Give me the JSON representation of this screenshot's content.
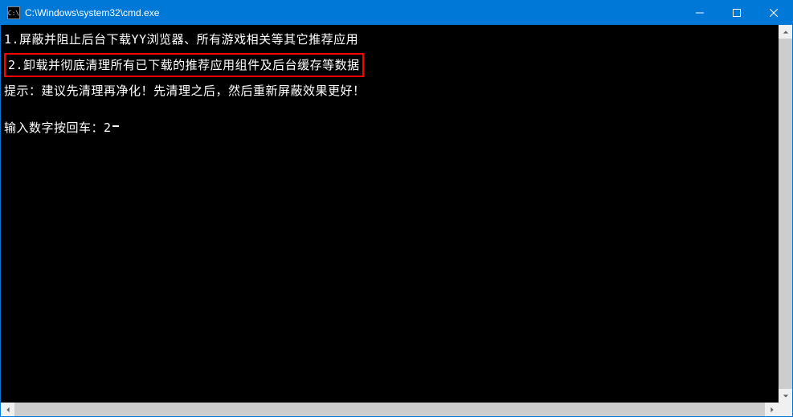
{
  "titlebar": {
    "icon_label": "C:\\",
    "title": "C:\\Windows\\system32\\cmd.exe"
  },
  "console": {
    "line1": "1.屏蔽并阻止后台下载YY浏览器、所有游戏相关等其它推荐应用",
    "line2": "2.卸载并彻底清理所有已下载的推荐应用组件及后台缓存等数据",
    "line3": "提示：建议先清理再净化！先清理之后，然后重新屏蔽效果更好！",
    "prompt_label": "输入数字按回车：",
    "input_value": "2"
  }
}
